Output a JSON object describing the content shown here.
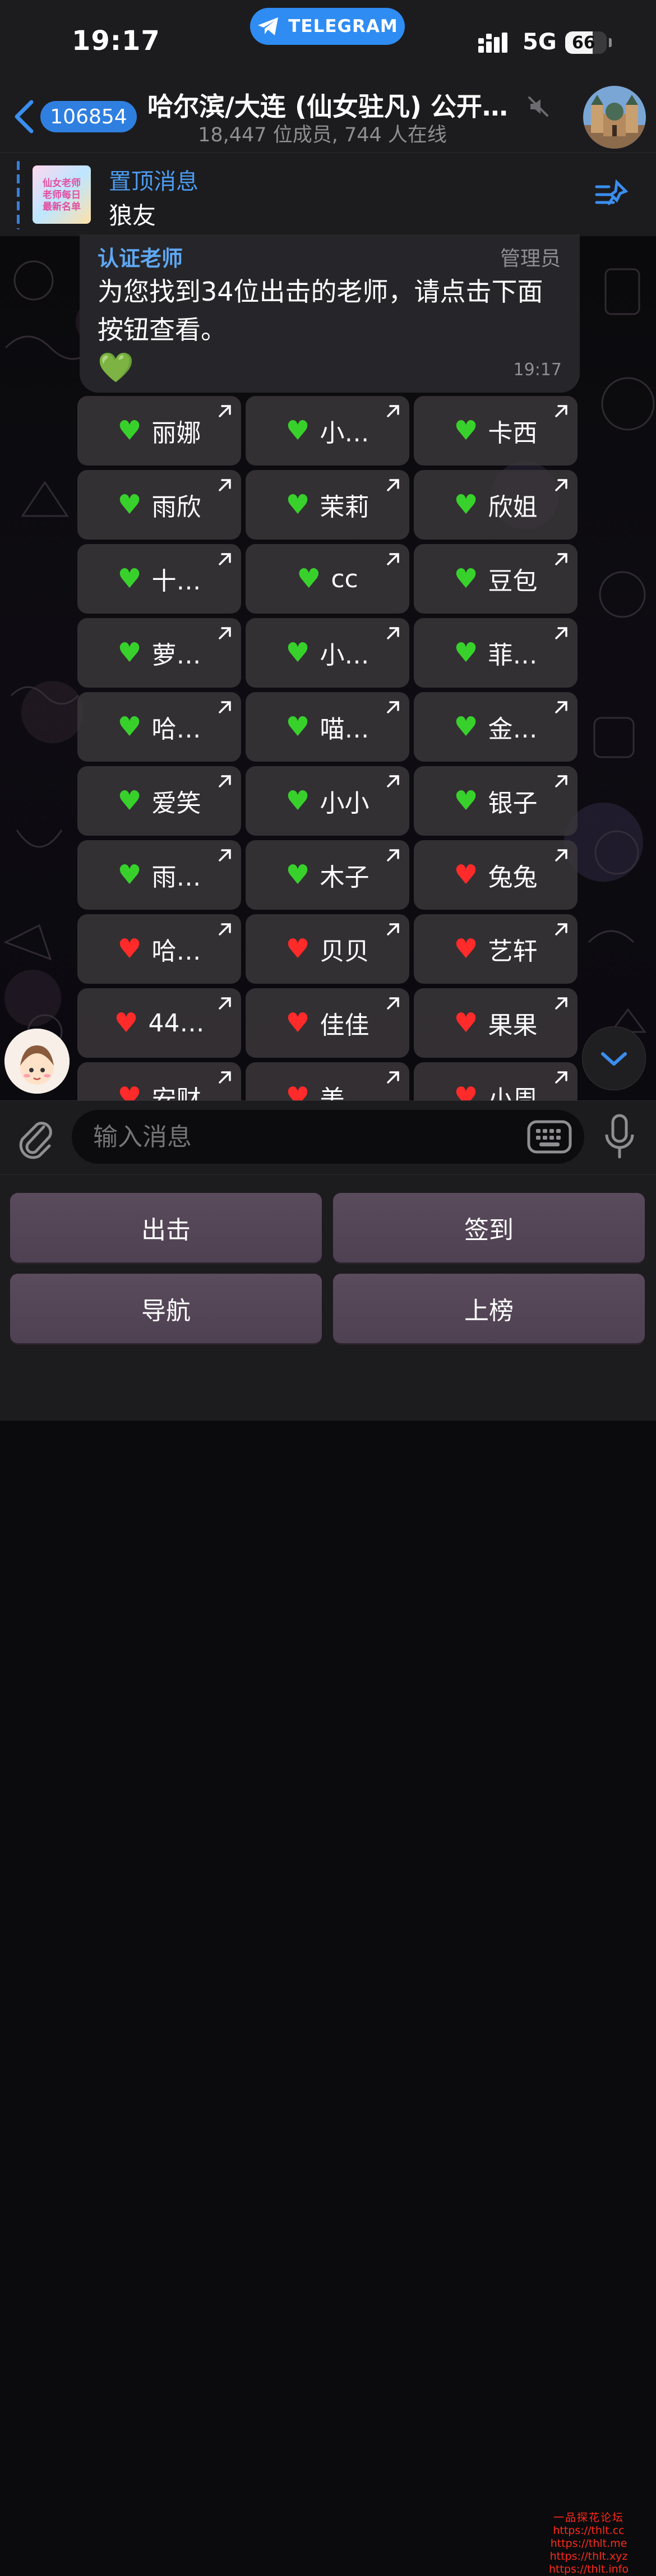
{
  "status_bar": {
    "time": "19:17",
    "app_pill": "TELEGRAM",
    "network": "5G",
    "battery_percent": "66",
    "battery_level": 0.66
  },
  "header": {
    "back_badge": "106854",
    "title": "哈尔滨/大连 (仙女驻凡) 公开…",
    "subtitle": "18,447 位成员, 744 人在线"
  },
  "pinned": {
    "title": "置顶消息",
    "text": "狼友",
    "thumb_text": "仙女老师\n老师每日\n最新名单"
  },
  "message": {
    "sender": "认证老师",
    "role": "管理员",
    "text": "为您找到34位出击的老师，请点击下面按钮查看。",
    "emoji": "💚",
    "time": "19:17"
  },
  "buttons": [
    {
      "label": "丽娜",
      "heart": "green"
    },
    {
      "label": "小…",
      "heart": "green"
    },
    {
      "label": "卡西",
      "heart": "green"
    },
    {
      "label": "雨欣",
      "heart": "green"
    },
    {
      "label": "茉莉",
      "heart": "green"
    },
    {
      "label": "欣姐",
      "heart": "green"
    },
    {
      "label": "十…",
      "heart": "green"
    },
    {
      "label": "cc",
      "heart": "green"
    },
    {
      "label": "豆包",
      "heart": "green"
    },
    {
      "label": "萝…",
      "heart": "green"
    },
    {
      "label": "小…",
      "heart": "green"
    },
    {
      "label": "菲…",
      "heart": "green"
    },
    {
      "label": "哈…",
      "heart": "green"
    },
    {
      "label": "喵…",
      "heart": "green"
    },
    {
      "label": "金…",
      "heart": "green"
    },
    {
      "label": "爱笑",
      "heart": "green"
    },
    {
      "label": "小小",
      "heart": "green"
    },
    {
      "label": "银子",
      "heart": "green"
    },
    {
      "label": "雨…",
      "heart": "green"
    },
    {
      "label": "木子",
      "heart": "green"
    },
    {
      "label": "兔兔",
      "heart": "red"
    },
    {
      "label": "哈…",
      "heart": "red"
    },
    {
      "label": "贝贝",
      "heart": "red"
    },
    {
      "label": "艺轩",
      "heart": "red"
    },
    {
      "label": "44…",
      "heart": "red"
    },
    {
      "label": "佳佳",
      "heart": "red"
    },
    {
      "label": "果果",
      "heart": "red"
    },
    {
      "label": "安财",
      "heart": "red"
    },
    {
      "label": "美…",
      "heart": "red"
    },
    {
      "label": "小周",
      "heart": "red"
    }
  ],
  "float_avatar_label": "认证老师",
  "composer": {
    "placeholder": "输入消息"
  },
  "reply_keyboard": [
    "出击",
    "签到",
    "导航",
    "上榜"
  ],
  "watermark": {
    "title": "一品探花论坛",
    "links": [
      "https://thlt.cc",
      "https://thlt.me",
      "https://thlt.xyz",
      "https://thlt.info"
    ]
  },
  "colors": {
    "accent": "#2f8cf3",
    "heart_green": "#38d12c",
    "heart_red": "#ff2a2a",
    "sender": "#5fa8f4"
  }
}
